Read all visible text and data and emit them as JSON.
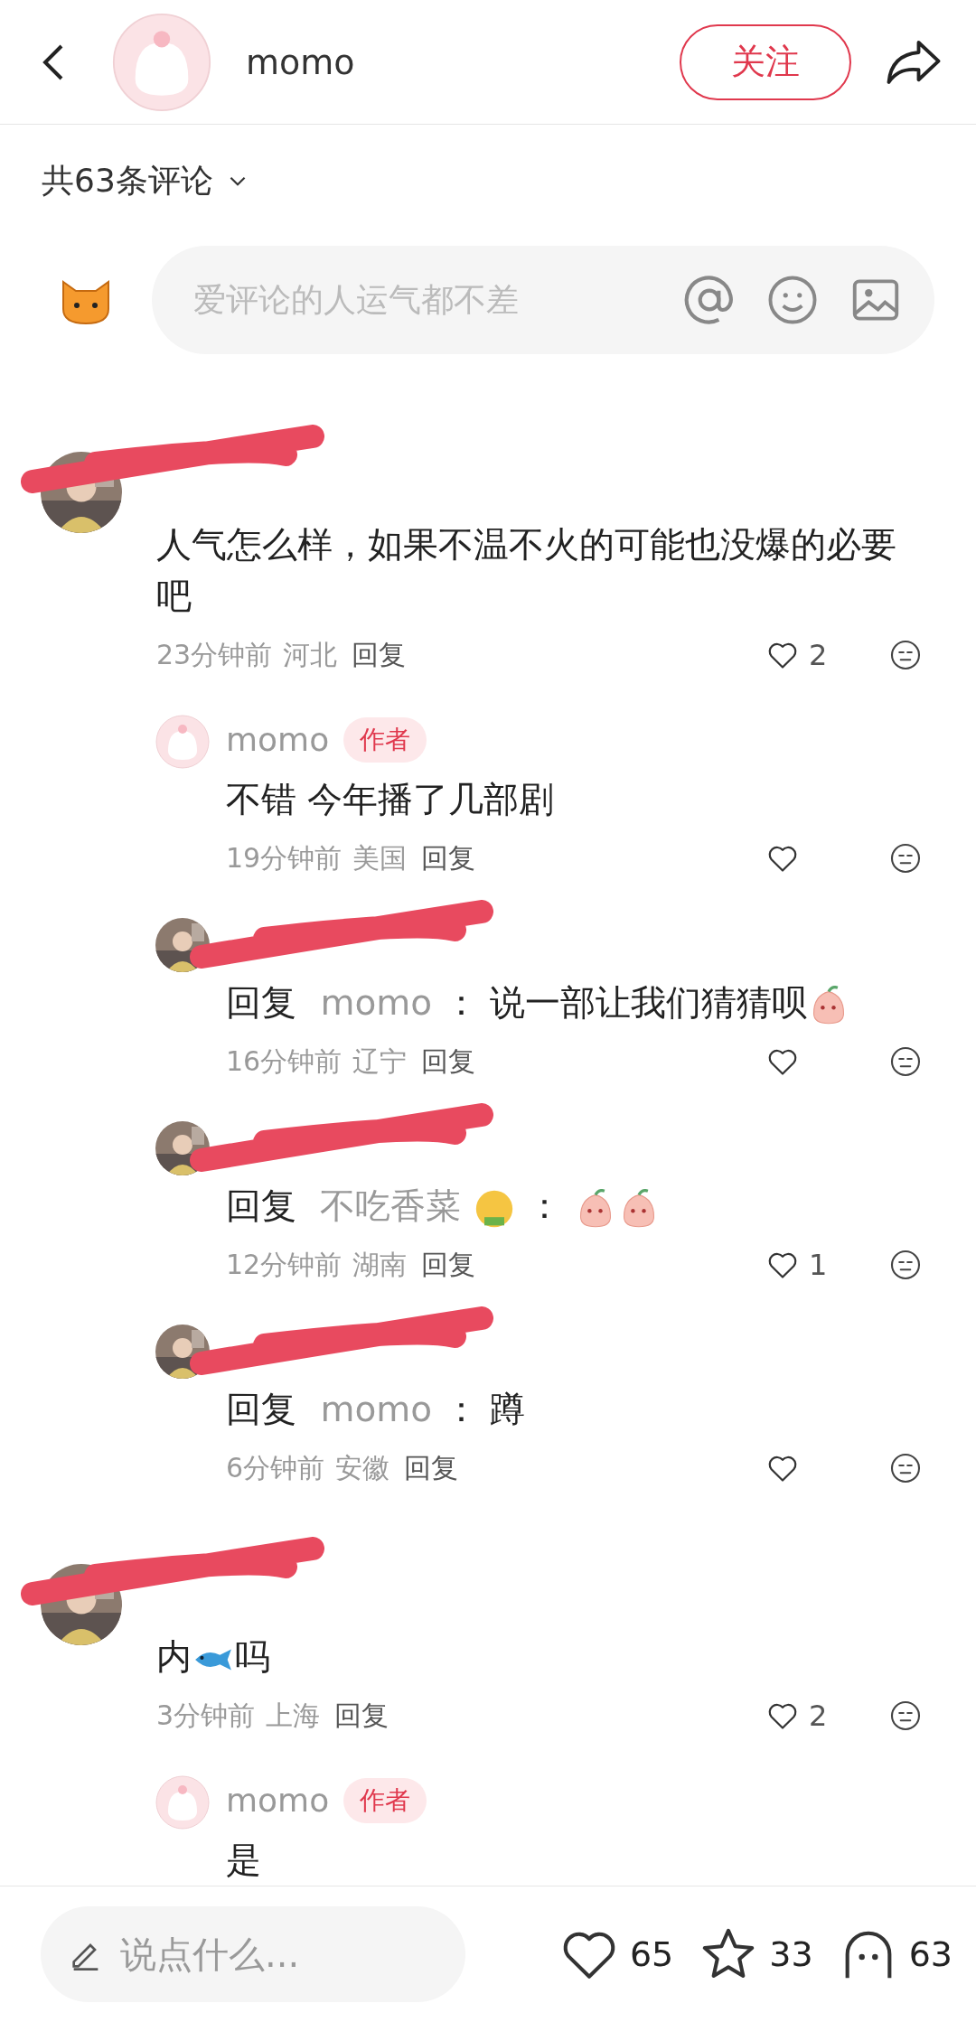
{
  "header": {
    "author_name": "momo",
    "follow_label": "关注"
  },
  "comment_count": "共63条评论",
  "comment_input": {
    "placeholder": "爱评论的人运气都不差"
  },
  "comments": [
    {
      "kind": "user",
      "segments": [
        {
          "kind": "text",
          "text": "人气怎么样，如果不温不火的可能也没爆的必要吧"
        }
      ],
      "time": "23分钟前",
      "location": "河北",
      "reply_label": "回复",
      "likes": "2",
      "replies": [
        {
          "kind": "author",
          "name": "momo",
          "author_tag": "作者",
          "segments": [
            {
              "kind": "text",
              "text": "不错 今年播了几部剧"
            }
          ],
          "time": "19分钟前",
          "location": "美国",
          "reply_label": "回复"
        },
        {
          "kind": "user",
          "reply_prefix": "回复",
          "reply_to": "momo",
          "separator": "：",
          "segments": [
            {
              "kind": "text",
              "text": "说一部让我们猜猜呗"
            },
            {
              "kind": "peach"
            }
          ],
          "time": "16分钟前",
          "location": "辽宁",
          "reply_label": "回复"
        },
        {
          "kind": "user",
          "reply_prefix": "回复",
          "reply_to": "不吃香菜",
          "reply_to_emoji": true,
          "separator": "：",
          "segments": [
            {
              "kind": "peach"
            },
            {
              "kind": "peach"
            }
          ],
          "time": "12分钟前",
          "location": "湖南",
          "reply_label": "回复",
          "likes": "1"
        },
        {
          "kind": "user",
          "reply_prefix": "回复",
          "reply_to": "momo",
          "separator": "：",
          "segments": [
            {
              "kind": "text",
              "text": "蹲"
            }
          ],
          "time": "6分钟前",
          "location": "安徽",
          "reply_label": "回复"
        }
      ]
    },
    {
      "kind": "user",
      "segments": [
        {
          "kind": "text",
          "text": "内"
        },
        {
          "kind": "fish"
        },
        {
          "kind": "text",
          "text": "吗"
        }
      ],
      "time": "3分钟前",
      "location": "上海",
      "reply_label": "回复",
      "likes": "2",
      "replies": [
        {
          "kind": "author",
          "name": "momo",
          "author_tag": "作者",
          "segments": [
            {
              "kind": "text",
              "text": "是"
            }
          ]
        }
      ]
    }
  ],
  "bottom_bar": {
    "placeholder": "说点什么...",
    "likes": "65",
    "stars": "33",
    "comments": "63"
  }
}
